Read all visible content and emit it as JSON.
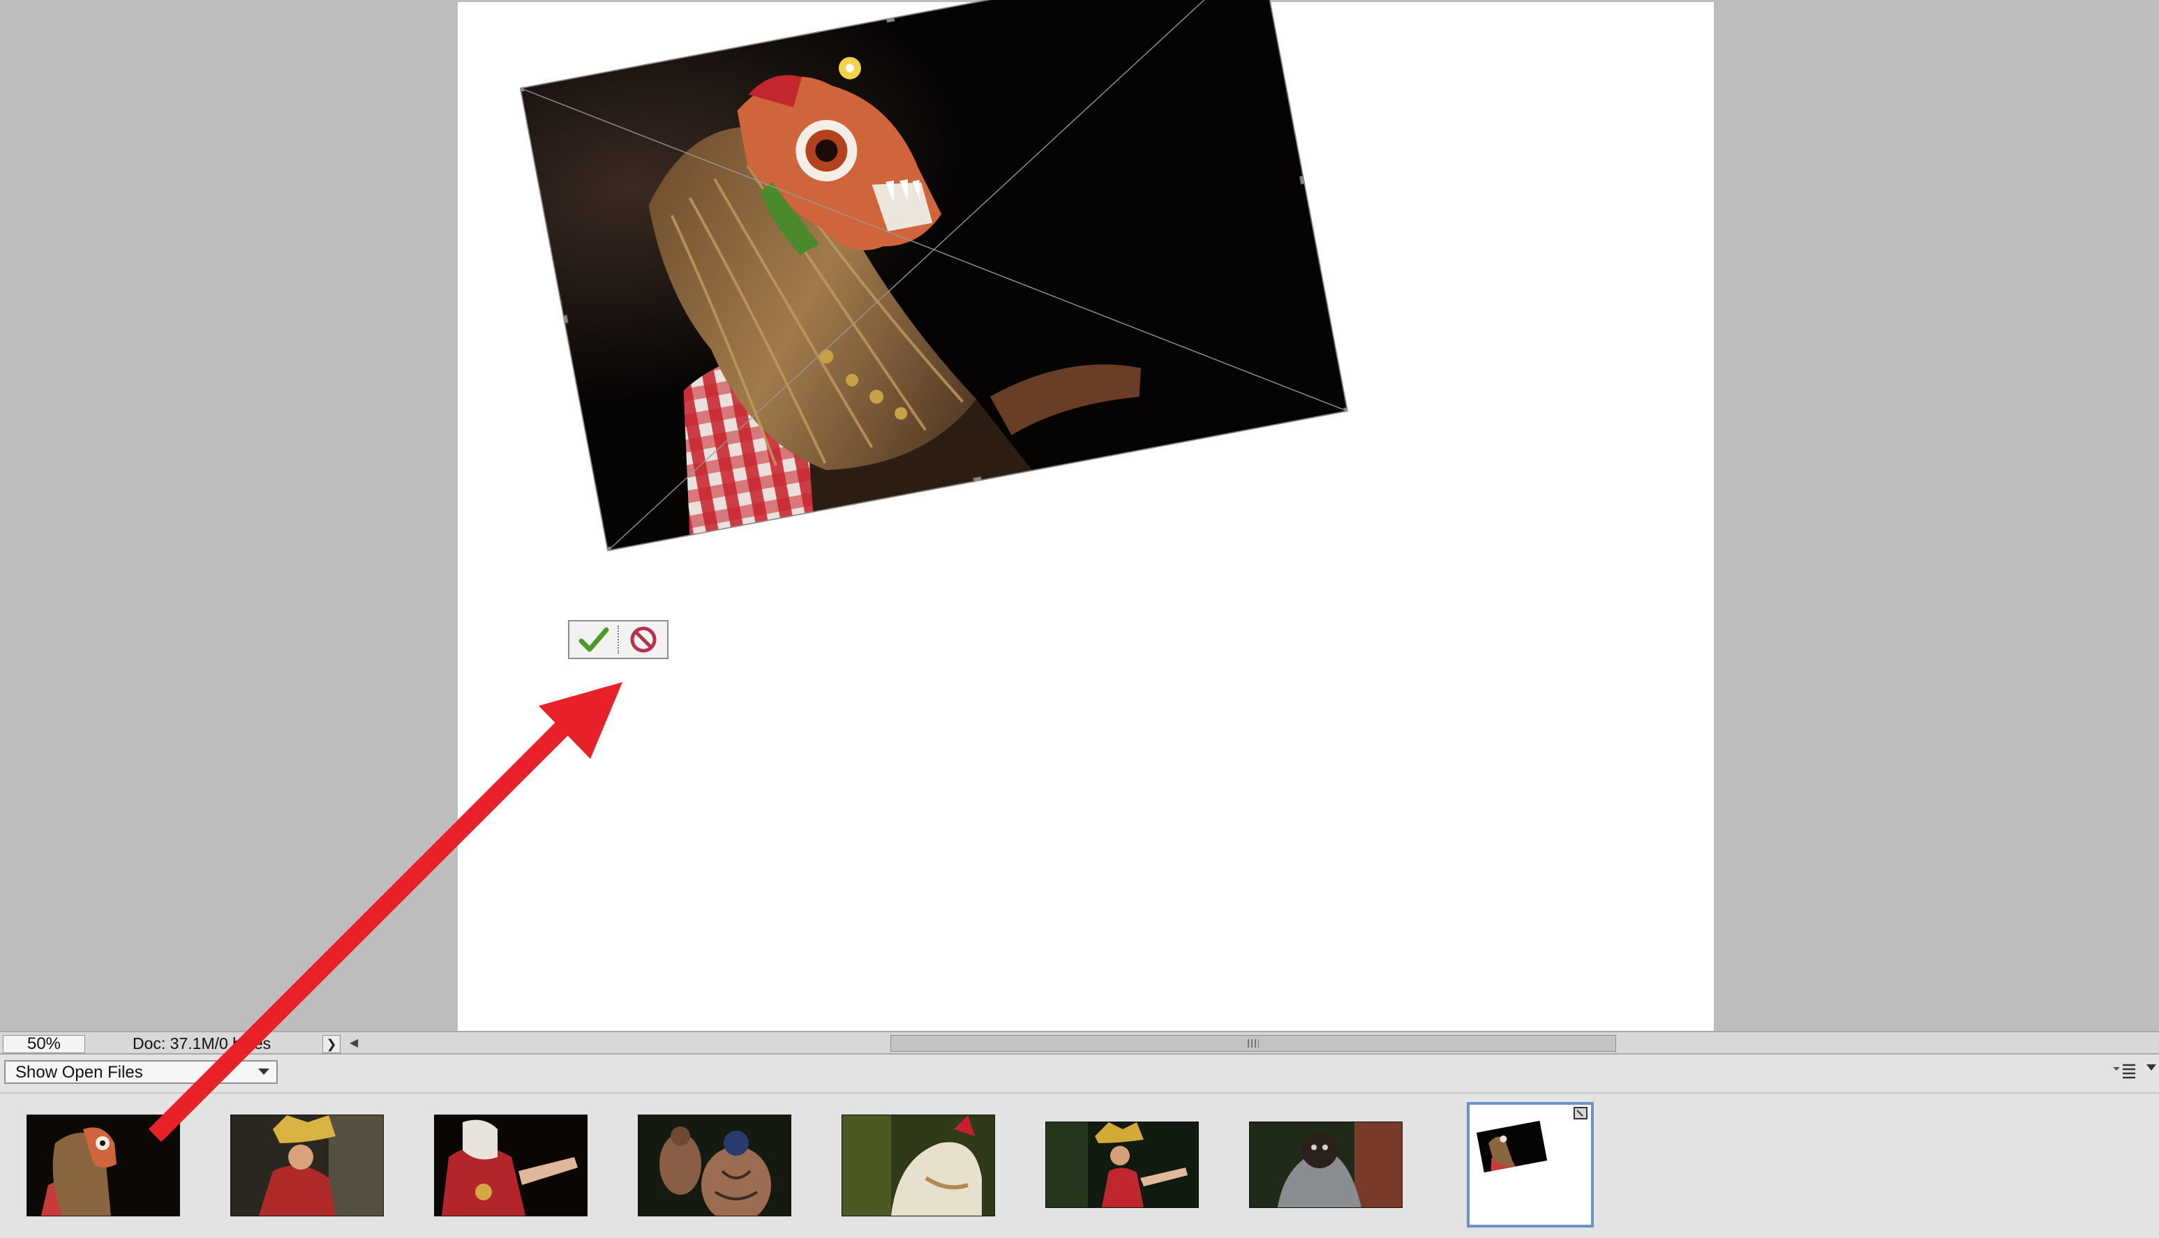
{
  "status_bar": {
    "zoom": "50%",
    "doc_info": "Doc: 37.1M/0 bytes",
    "menu_arrow": "❯",
    "scroll_left": "◀"
  },
  "transform": {
    "commit_icon": "checkmark-icon",
    "cancel_icon": "cancel-icon",
    "commit_color": "#4c9a2a",
    "cancel_color": "#b8314a"
  },
  "annotation": {
    "arrow_color": "#e8202a"
  },
  "photo_bin": {
    "dropdown_value": "Show Open Files",
    "options_icon": "bin-options-icon",
    "thumbnails": [
      {
        "label": "masked dancer with long hair"
      },
      {
        "label": "dancer in golden headdress"
      },
      {
        "label": "masked dancer in red costume"
      },
      {
        "label": "tattooed performers"
      },
      {
        "label": "white lion costume"
      },
      {
        "label": "dancer with headdress gesturing"
      },
      {
        "label": "dark furry mask performer"
      },
      {
        "label": "current composite document"
      }
    ]
  },
  "colors": {
    "workspace": "#bdbdbd",
    "bin_background": "#e3e3e3",
    "selection_border": "#6c93c9"
  }
}
